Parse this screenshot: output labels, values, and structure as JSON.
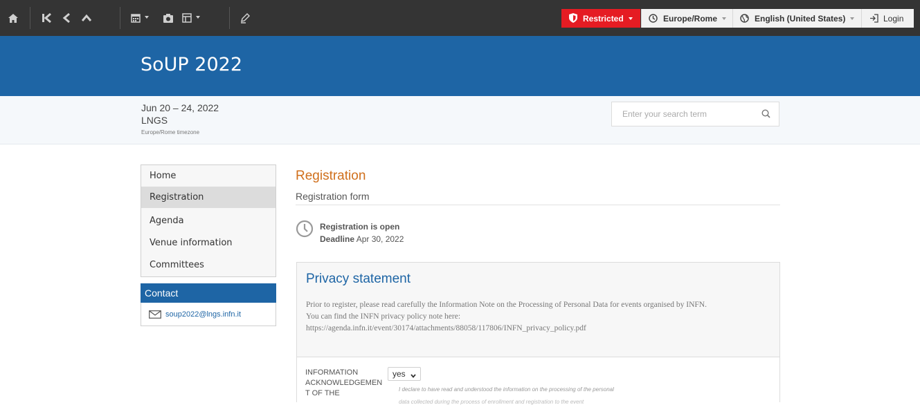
{
  "toolbar": {
    "icons": [
      "home-icon",
      "first-page-icon",
      "back-icon",
      "up-icon",
      "calendar-icon",
      "camera-icon",
      "layout-icon",
      "edit-icon"
    ],
    "restricted_label": "Restricted",
    "timezone_label": "Europe/Rome",
    "language_label": "English (United States)",
    "login_label": "Login",
    "colors": {
      "restricted_bg": "#e51c23",
      "bar_bg": "#343434"
    }
  },
  "header": {
    "title": "SoUP 2022",
    "bg": "#1e65a5"
  },
  "info": {
    "dates": "Jun 20 – 24, 2022",
    "venue": "LNGS",
    "timezone_note": "Europe/Rome timezone"
  },
  "search": {
    "placeholder": "Enter your search term"
  },
  "sidebar": {
    "items": [
      {
        "label": "Home"
      },
      {
        "label": "Registration",
        "active": true
      },
      {
        "label": "Agenda"
      },
      {
        "label": "Venue information"
      },
      {
        "label": "Committees"
      }
    ],
    "contact": {
      "heading": "Contact",
      "email": "soup2022@lngs.infn.it"
    }
  },
  "main": {
    "title": "Registration",
    "subtitle": "Registration form",
    "status": "Registration is open",
    "deadline_label": "Deadline",
    "deadline_value": "Apr 30, 2022",
    "privacy": {
      "title": "Privacy statement",
      "line1": "Prior to register, please read carefully the Information Note on the Processing of Personal Data for events organised by INFN.",
      "line2": "You can find the INFN privacy policy note here:",
      "line3": "https://agenda.infn.it/event/30174/attachments/88058/117806/INFN_privacy_policy.pdf",
      "field_label": "INFORMATION ACKNOWLEDGEMEN T OF THE",
      "select_value": "yes",
      "declaration": "I declare to have read and understood the information on the processing of the personal",
      "declaration_cont": "data collected during the process of enrollment and registration to the event"
    }
  }
}
